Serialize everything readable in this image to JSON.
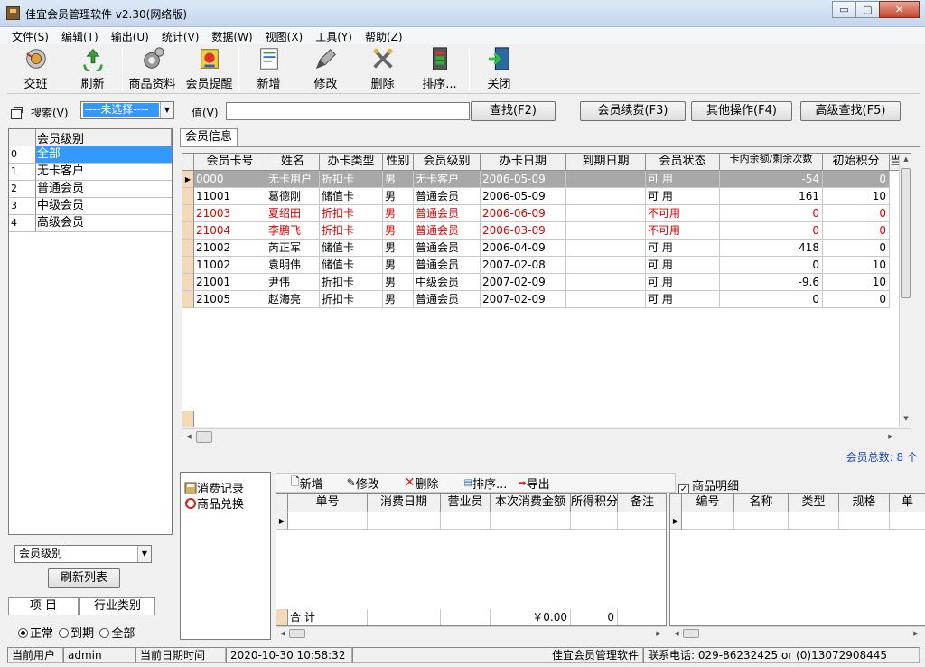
{
  "window": {
    "title": "佳宜会员管理软件 v2.30(网络版)",
    "min": "▭",
    "max": "▢",
    "close": "✕"
  },
  "menu": [
    "文件(S)",
    "编辑(T)",
    "输出(U)",
    "统计(V)",
    "数据(W)",
    "视图(X)",
    "工具(Y)",
    "帮助(Z)"
  ],
  "toolbar": {
    "jiaoban": "交班",
    "refresh": "刷新",
    "goods": "商品资料",
    "remind": "会员提醒",
    "add": "新增",
    "edit": "修改",
    "delete": "删除",
    "sort": "排序...",
    "close": "关闭"
  },
  "search": {
    "label": "搜索(V)",
    "combo": "----未选择----",
    "value_label": "值(V)",
    "value": "",
    "find": "查找(F2)",
    "renew": "会员续费(F3)",
    "other": "其他操作(F4)",
    "advanced": "高级查找(F5)"
  },
  "level_list": {
    "header": "会员级别",
    "rows": [
      {
        "idx": "0",
        "name": "全部"
      },
      {
        "idx": "1",
        "name": "无卡客户"
      },
      {
        "idx": "2",
        "name": "普通会员"
      },
      {
        "idx": "3",
        "name": "中级会员"
      },
      {
        "idx": "4",
        "name": "高级会员"
      }
    ]
  },
  "main_tab": "会员信息",
  "member_table": {
    "columns": [
      "会员卡号",
      "姓名",
      "办卡类型",
      "性别",
      "会员级别",
      "办卡日期",
      "到期日期",
      "会员状态",
      "卡内余额/剩余次数",
      "初始积分",
      "当"
    ],
    "rows": [
      [
        "0000",
        "无卡用户",
        "折扣卡",
        "男",
        "无卡客户",
        "2006-05-09",
        "",
        "可  用",
        "-54",
        "0"
      ],
      [
        "11001",
        "葛德刚",
        "储值卡",
        "男",
        "普通会员",
        "2006-05-09",
        "",
        "可  用",
        "161",
        "10"
      ],
      [
        "21003",
        "夏绍田",
        "折扣卡",
        "男",
        "普通会员",
        "2006-06-09",
        "",
        "不可用",
        "0",
        "0"
      ],
      [
        "21004",
        "李鹏飞",
        "折扣卡",
        "男",
        "普通会员",
        "2006-03-09",
        "",
        "不可用",
        "0",
        "0"
      ],
      [
        "21002",
        "芮正军",
        "储值卡",
        "男",
        "普通会员",
        "2006-04-09",
        "",
        "可  用",
        "418",
        "0"
      ],
      [
        "11002",
        "袁明伟",
        "储值卡",
        "男",
        "普通会员",
        "2007-02-08",
        "",
        "可  用",
        "0",
        "10"
      ],
      [
        "21001",
        "尹伟",
        "折扣卡",
        "男",
        "中级会员",
        "2007-02-09",
        "",
        "可  用",
        "-9.6",
        "10"
      ],
      [
        "21005",
        "赵海亮",
        "折扣卡",
        "男",
        "普通会员",
        "2007-02-09",
        "",
        "可  用",
        "0",
        "0"
      ]
    ],
    "disabled_color": "#e00000"
  },
  "member_total": {
    "label": "会员总数:",
    "value": "8 个"
  },
  "lower_nav": {
    "consume": "消费记录",
    "exchange": "商品兑换"
  },
  "lower_toolbar": {
    "add": "新增",
    "edit": "修改",
    "delete": "删除",
    "sort": "排序...",
    "export": "导出"
  },
  "consume_table": {
    "columns": [
      "单号",
      "消费日期",
      "营业员",
      "本次消费金额",
      "所得积分",
      "备注"
    ],
    "sum_label": "合  计",
    "sum_amount": "￥0.00",
    "sum_points": "0"
  },
  "goods_detail": {
    "label": "商品明细",
    "checked": "✓",
    "columns": [
      "编号",
      "名称",
      "类型",
      "规格",
      "单"
    ]
  },
  "left_bottom": {
    "combo": "会员级别",
    "refresh": "刷新列表",
    "col1": "项   目",
    "col2": "行业类别",
    "radio_normal": "正常",
    "radio_expired": "到期",
    "radio_all": "全部"
  },
  "status": {
    "user_label": "当前用户",
    "user": "admin",
    "date_label": "当前日期时间",
    "date": "2020-10-30 10:58:32",
    "app": "佳宜会员管理软件",
    "phone": "联系电话: 029-86232425 or (0)13072908445"
  }
}
